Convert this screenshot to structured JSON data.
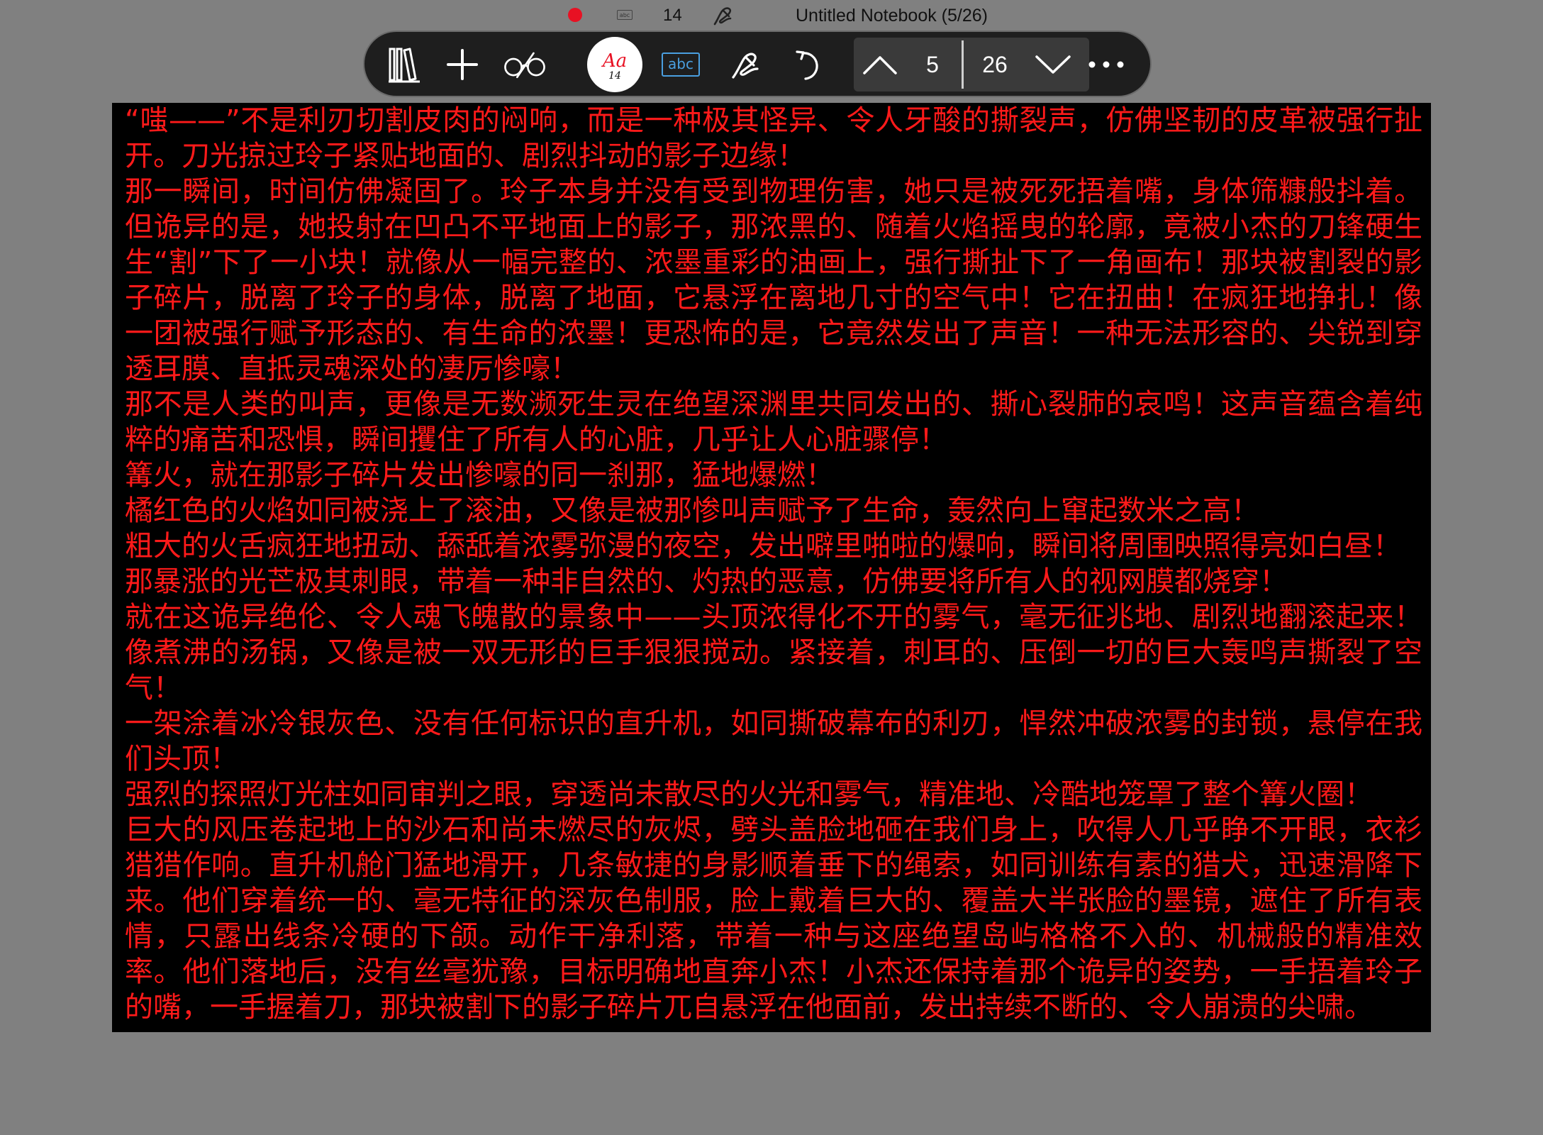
{
  "status_bar": {
    "abc_label": "abc",
    "font_size": "14",
    "title": "Untitled Notebook (5/26)"
  },
  "toolbar": {
    "font_button": {
      "label": "Aa",
      "size": "14"
    },
    "abc_label": "abc",
    "page_nav": {
      "current": "5",
      "total": "26"
    }
  },
  "colors": {
    "background": "#808080",
    "toolbar": "#1e1e1e",
    "page": "#000000",
    "text": "#ff1a1a",
    "accent_red": "#e81123",
    "abc_blue": "#4a9fe0"
  },
  "icons": {
    "library": "library-icon",
    "add": "plus-icon",
    "reading_mode": "glasses-icon",
    "handwriting": "signature-icon",
    "undo": "undo-icon",
    "prev": "chevron-up-icon",
    "next": "chevron-down-icon",
    "more": "more-icon"
  },
  "document": {
    "paragraphs": [
      "“嗤——”不是利刃切割皮肉的闷响，而是一种极其怪异、令人牙酸的撕裂声，仿佛坚韧的皮革被强行扯开。刀光掠过玲子紧贴地面的、剧烈抖动的影子边缘！",
      "那一瞬间，时间仿佛凝固了。玲子本身并没有受到物理伤害，她只是被死死捂着嘴，身体筛糠般抖着。但诡异的是，她投射在凹凸不平地面上的影子，那浓黑的、随着火焰摇曳的轮廓，竟被小杰的刀锋硬生生“割”下了一小块！就像从一幅完整的、浓墨重彩的油画上，强行撕扯下了一角画布！那块被割裂的影子碎片，脱离了玲子的身体，脱离了地面，它悬浮在离地几寸的空气中！它在扭曲！在疯狂地挣扎！像一团被强行赋予形态的、有生命的浓墨！更恐怖的是，它竟然发出了声音！一种无法形容的、尖锐到穿透耳膜、直抵灵魂深处的凄厉惨嚎！",
      "那不是人类的叫声，更像是无数濒死生灵在绝望深渊里共同发出的、撕心裂肺的哀鸣！这声音蕴含着纯粹的痛苦和恐惧，瞬间攫住了所有人的心脏，几乎让人心脏骤停！",
      "篝火，就在那影子碎片发出惨嚎的同一刹那，猛地爆燃！",
      "橘红色的火焰如同被浇上了滚油，又像是被那惨叫声赋予了生命，轰然向上窜起数米之高！",
      "粗大的火舌疯狂地扭动、舔舐着浓雾弥漫的夜空，发出噼里啪啦的爆响，瞬间将周围映照得亮如白昼！",
      "那暴涨的光芒极其刺眼，带着一种非自然的、灼热的恶意，仿佛要将所有人的视网膜都烧穿！",
      "就在这诡异绝伦、令人魂飞魄散的景象中——头顶浓得化不开的雾气，毫无征兆地、剧烈地翻滚起来！像煮沸的汤锅，又像是被一双无形的巨手狠狠搅动。紧接着，刺耳的、压倒一切的巨大轰鸣声撕裂了空气！",
      "一架涂着冰冷银灰色、没有任何标识的直升机，如同撕破幕布的利刃，悍然冲破浓雾的封锁，悬停在我们头顶！",
      "强烈的探照灯光柱如同审判之眼，穿透尚未散尽的火光和雾气，精准地、冷酷地笼罩了整个篝火圈！",
      "巨大的风压卷起地上的沙石和尚未燃尽的灰烬，劈头盖脸地砸在我们身上，吹得人几乎睁不开眼，衣衫猎猎作响。直升机舱门猛地滑开，几条敏捷的身影顺着垂下的绳索，如同训练有素的猎犬，迅速滑降下来。他们穿着统一的、毫无特征的深灰色制服，脸上戴着巨大的、覆盖大半张脸的墨镜，遮住了所有表情，只露出线条冷硬的下颌。动作干净利落，带着一种与这座绝望岛屿格格不入的、机械般的精准效率。他们落地后，没有丝毫犹豫，目标明确地直奔小杰！小杰还保持着那个诡异的姿势，一手捂着玲子的嘴，一手握着刀，那块被割下的影子碎片兀自悬浮在他面前，发出持续不断的、令人崩溃的尖啸。"
    ]
  }
}
